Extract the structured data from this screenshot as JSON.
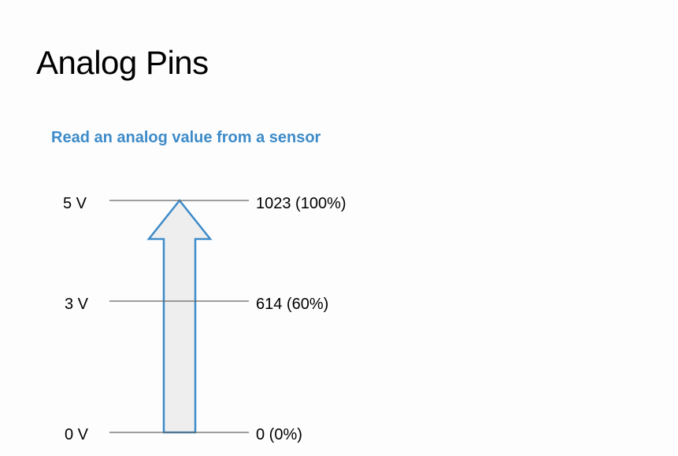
{
  "title": "Analog Pins",
  "subtitle": "Read an analog value from a sensor",
  "colors": {
    "subtitle": "#3d8bc9",
    "arrow_stroke": "#3d8bc9",
    "arrow_fill": "#eeeeee",
    "lines": "#666666"
  },
  "levels": [
    {
      "voltage": "5 V",
      "reading": "1023 (100%)"
    },
    {
      "voltage": "3 V",
      "reading": "614 (60%)"
    },
    {
      "voltage": "0 V",
      "reading": "0 (0%)"
    }
  ]
}
